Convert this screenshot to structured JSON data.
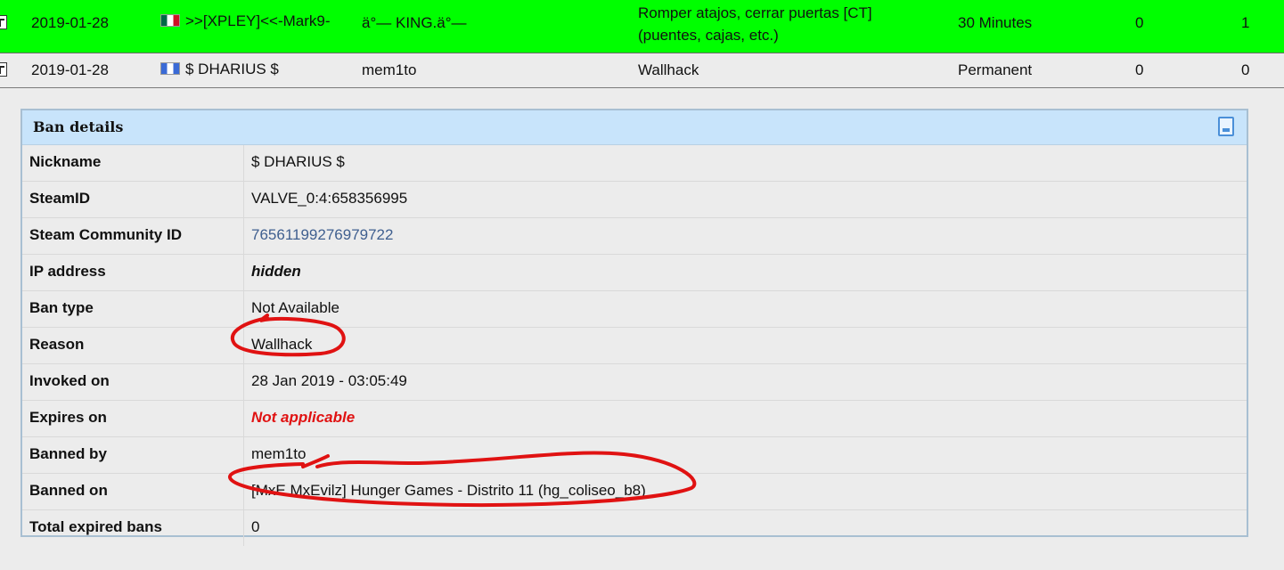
{
  "ban_list": {
    "rows": [
      {
        "date": "2019-01-28",
        "player": ">>[XPLEY]<<-Mark9-",
        "admin": "ä°— KING.ä°—",
        "reason": "Romper atajos, cerrar puertas [CT] (puentes, cajas, etc.)",
        "length": "30 Minutes",
        "col_a": "0",
        "col_b": "1",
        "highlight_color": "#00ff00"
      },
      {
        "date": "2019-01-28",
        "player": "$ DHARIUS $",
        "admin": "mem1to",
        "reason": "Wallhack",
        "length": "Permanent",
        "col_a": "0",
        "col_b": "0",
        "highlight_color": "#ececec"
      }
    ]
  },
  "details": {
    "title": "Ban details",
    "rows": [
      {
        "label": "Nickname",
        "value": "$ DHARIUS $"
      },
      {
        "label": "SteamID",
        "value": "VALVE_0:4:658356995"
      },
      {
        "label": "Steam Community ID",
        "value": "76561199276979722"
      },
      {
        "label": "IP address",
        "value": "hidden"
      },
      {
        "label": "Ban type",
        "value": "Not Available"
      },
      {
        "label": "Reason",
        "value": "Wallhack"
      },
      {
        "label": "Invoked on",
        "value": "28 Jan 2019 - 03:05:49"
      },
      {
        "label": "Expires on",
        "value": "Not applicable"
      },
      {
        "label": "Banned by",
        "value": "mem1to"
      },
      {
        "label": "Banned on",
        "value": "[MxE MxEvilz] Hunger Games - Distrito 11 (hg_coliseo_b8)"
      },
      {
        "label": "Total expired bans",
        "value": "0"
      }
    ]
  },
  "icons": {
    "row_action": "demo-file-icon",
    "flag_row_1": "mexico-flag-icon",
    "flag_row_2": "france-flag-icon",
    "details_corner": "document-icon"
  },
  "colors": {
    "highlight_green": "#00ff00",
    "header_blue": "#c8e4fb",
    "annotation_red": "#e01212",
    "link_blue": "#3f5f8f"
  }
}
